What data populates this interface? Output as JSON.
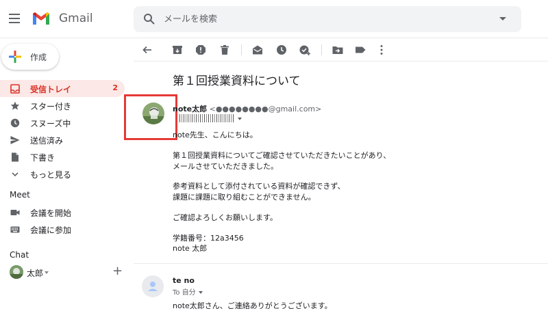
{
  "app": {
    "name": "Gmail"
  },
  "search": {
    "placeholder": "メールを検索"
  },
  "sidebar": {
    "compose_label": "作成",
    "items": [
      {
        "label": "受信トレイ",
        "count": "2",
        "icon": "inbox-icon"
      },
      {
        "label": "スター付き",
        "icon": "star-icon"
      },
      {
        "label": "スヌーズ中",
        "icon": "clock-icon"
      },
      {
        "label": "送信済み",
        "icon": "send-icon"
      },
      {
        "label": "下書き",
        "icon": "draft-icon"
      },
      {
        "label": "もっと見る",
        "icon": "chevron-down-icon"
      }
    ],
    "meet": {
      "title": "Meet",
      "items": [
        {
          "label": "会議を開始",
          "icon": "video-icon"
        },
        {
          "label": "会議に参加",
          "icon": "keyboard-icon"
        }
      ]
    },
    "chat": {
      "title": "Chat",
      "user": "太郎"
    }
  },
  "toolbar": {
    "icons": [
      "back-icon",
      "archive-icon",
      "report-spam-icon",
      "delete-icon",
      "mark-unread-icon",
      "snooze-icon",
      "add-task-icon",
      "move-to-icon",
      "label-icon",
      "more-icon"
    ]
  },
  "message": {
    "subject": "第１回授業資料について",
    "sender_name": "note太郎",
    "sender_email": "<●●●●●●●●@gmail.com>",
    "recipient_prefix": "To",
    "body": [
      "note先生、こんにちは。",
      "第１回授業資料についてご確認させていただきたいことがあり、",
      "メールさせていただきました。",
      "参考資料として添付されている資料が確認できず、",
      "課題に課題に取り組むことができません。",
      "ご確認よろしくお願いします。",
      "学籍番号：12a3456",
      "note 太郎"
    ]
  },
  "reply": {
    "sender": "te no",
    "to": "To 自分",
    "body": "note太郎さん、ご連絡ありがとうございます。"
  },
  "colors": {
    "accent_red": "#d93025",
    "highlight_box": "#e53935"
  }
}
